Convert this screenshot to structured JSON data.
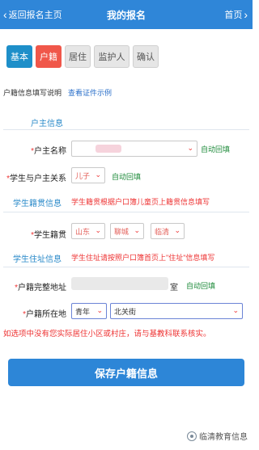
{
  "header": {
    "back_label": "返回报名主页",
    "title": "我的报名",
    "home_label": "首页"
  },
  "tabs": [
    {
      "label": "基本"
    },
    {
      "label": "户籍"
    },
    {
      "label": "居住"
    },
    {
      "label": "监护人"
    },
    {
      "label": "确认"
    }
  ],
  "info": {
    "instruction": "户籍信息填写说明",
    "example_link": "查看证件示例"
  },
  "section_householder": {
    "title": "户主信息"
  },
  "householder_name": {
    "label": "户主名称",
    "value": "",
    "auto": "自动回填"
  },
  "relation": {
    "label": "学生与户主关系",
    "value": "儿子",
    "auto": "自动回填"
  },
  "native_place_section": {
    "title": "学生籍贯信息",
    "hint": "学生籍贯根据户口簿儿童页上籍贯信息填写"
  },
  "native_place": {
    "label": "学生籍贯",
    "province": "山东",
    "city": "聊城",
    "county": "临清"
  },
  "address_section": {
    "title": "学生住址信息",
    "hint": "学生住址请按照户口簿首页上\"住址\"信息填写"
  },
  "full_address": {
    "label": "户籍完整地址",
    "suffix": "室",
    "auto": "自动回填"
  },
  "district": {
    "label": "户籍所在地",
    "town": "青年",
    "street": "北关街"
  },
  "warning": "如选项中没有您实际居住小区或村庄，请与基教科联系核实。",
  "save_label": "保存户籍信息",
  "watermark": "临清教育信息"
}
